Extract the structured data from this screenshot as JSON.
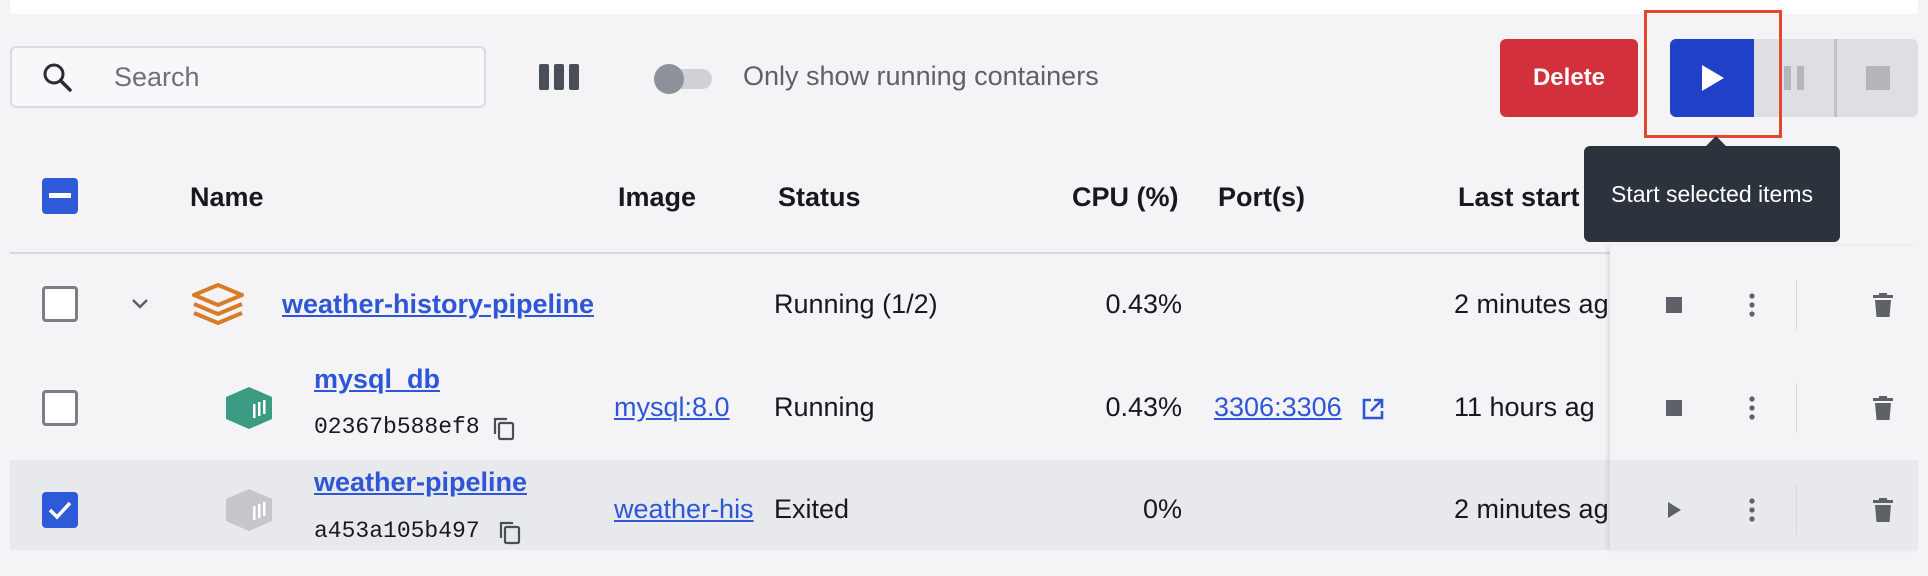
{
  "toolbar": {
    "search_placeholder": "Search",
    "toggle_label": "Only show running containers",
    "delete_label": "Delete",
    "tooltip": "Start selected items"
  },
  "table": {
    "headers": {
      "name": "Name",
      "image": "Image",
      "status": "Status",
      "cpu": "CPU (%)",
      "ports": "Port(s)",
      "last_started": "Last start"
    },
    "rows": [
      {
        "name": "weather-history-pipeline",
        "id": "",
        "image": "",
        "status": "Running (1/2)",
        "cpu": "0.43%",
        "ports": "",
        "last_started": "2 minutes ag"
      },
      {
        "name": "mysql_db",
        "id": "02367b588ef8",
        "image": "mysql:8.0",
        "status": "Running",
        "cpu": "0.43%",
        "ports": "3306:3306",
        "last_started": "11 hours ag"
      },
      {
        "name": "weather-pipeline",
        "id": "a453a105b497",
        "image": "weather-his",
        "status": "Exited",
        "cpu": "0%",
        "ports": "",
        "last_started": "2 minutes ag"
      }
    ]
  },
  "colors": {
    "accent": "#2e5ad9",
    "delete": "#d2303a",
    "highlight": "#e2472f",
    "compose_icon": "#d97c2a",
    "running_icon": "#3e9b83",
    "exited_icon": "#c5c7cc"
  },
  "icons": [
    "search-icon",
    "columns-icon",
    "play-icon",
    "pause-icon",
    "stop-icon",
    "chevron-down-icon",
    "stack-icon",
    "container-icon",
    "copy-icon",
    "external-link-icon",
    "kebab-icon",
    "trash-icon"
  ]
}
